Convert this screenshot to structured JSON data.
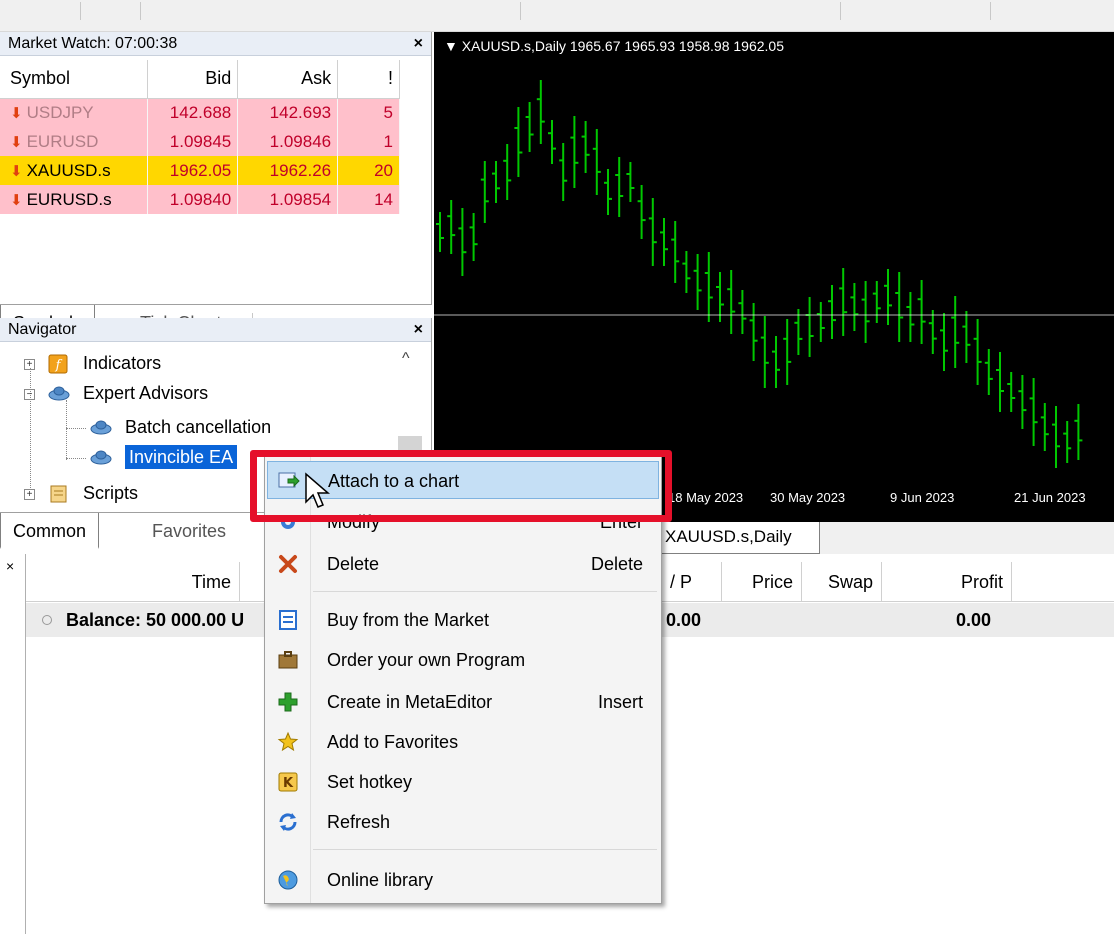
{
  "market_watch": {
    "title": "Market Watch: 07:00:38",
    "columns": [
      "Symbol",
      "Bid",
      "Ask",
      "!"
    ],
    "rows": [
      {
        "symbol": "USDJPY",
        "bid": "142.688",
        "ask": "142.693",
        "spread": "5"
      },
      {
        "symbol": "EURUSD",
        "bid": "1.09845",
        "ask": "1.09846",
        "spread": "1"
      },
      {
        "symbol": "XAUUSD.s",
        "bid": "1962.05",
        "ask": "1962.26",
        "spread": "20"
      },
      {
        "symbol": "EURUSD.s",
        "bid": "1.09840",
        "ask": "1.09854",
        "spread": "14"
      }
    ],
    "tabs": [
      "Symbols",
      "Tick Chart"
    ]
  },
  "navigator": {
    "title": "Navigator",
    "items": [
      "Indicators",
      "Expert Advisors",
      "Batch cancellation",
      "Invincible EA",
      "Scripts"
    ],
    "tabs": [
      "Common",
      "Favorites"
    ]
  },
  "chart": {
    "title": "XAUUSD.s,Daily  1965.67 1965.93 1958.98 1962.05",
    "tab_label": "XAUUSD.s,Daily",
    "date_labels": [
      "18 May 2023",
      "30 May 2023",
      "9 Jun 2023",
      "21 Jun 2023"
    ]
  },
  "terminal": {
    "columns": [
      "Time",
      "/ P",
      "Price",
      "Swap",
      "Profit"
    ],
    "balance_label": "Balance: 50 000.00 U",
    "balance_value1": "0.00",
    "balance_value2": "0.00"
  },
  "context_menu": {
    "items": [
      {
        "label": "Attach to a chart",
        "shortcut": ""
      },
      {
        "label": "Modify",
        "shortcut": "Enter"
      },
      {
        "label": "Delete",
        "shortcut": "Delete"
      },
      {
        "label": "Buy from the Market",
        "shortcut": ""
      },
      {
        "label": "Order your own Program",
        "shortcut": ""
      },
      {
        "label": "Create in MetaEditor",
        "shortcut": "Insert"
      },
      {
        "label": "Add to Favorites",
        "shortcut": ""
      },
      {
        "label": "Set hotkey",
        "shortcut": ""
      },
      {
        "label": "Refresh",
        "shortcut": ""
      },
      {
        "label": "Online library",
        "shortcut": ""
      }
    ]
  },
  "colors": {
    "chart_bg": "#000000",
    "bar_color": "#00c800",
    "highlight_box": "#e5102a",
    "selection": "#0a64d8"
  }
}
